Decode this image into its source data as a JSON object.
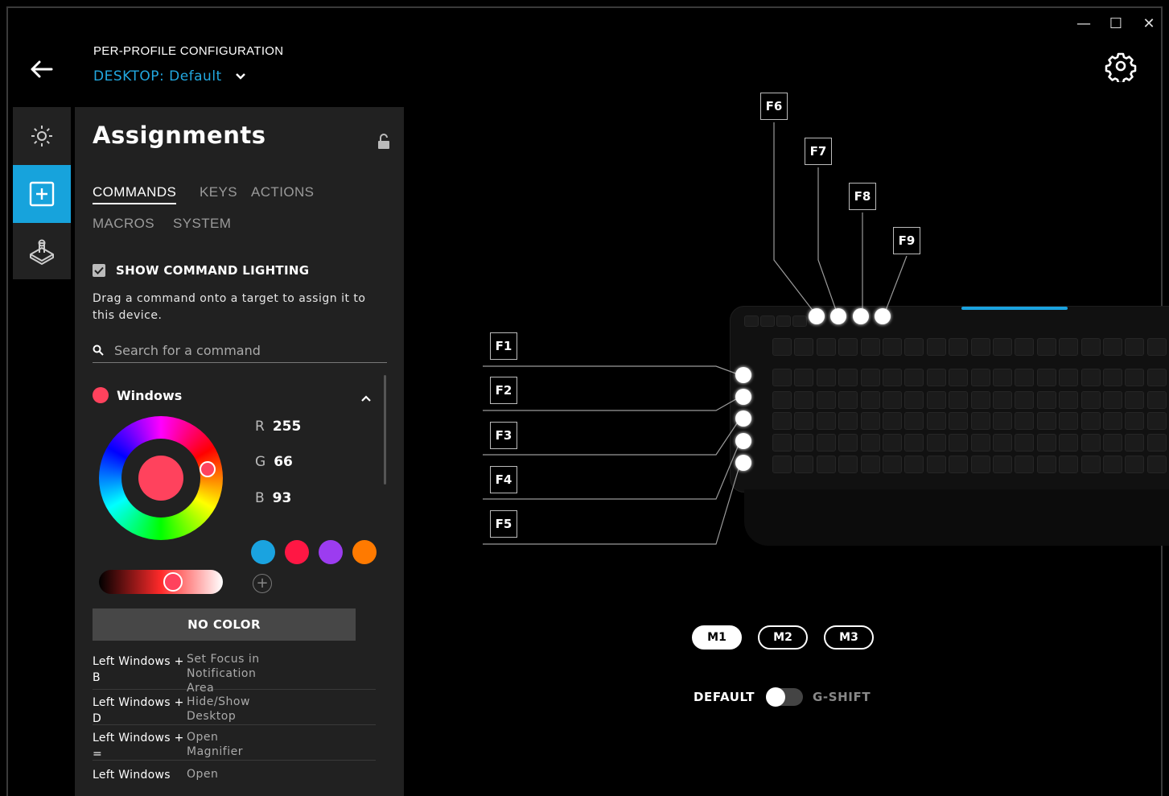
{
  "window": {
    "minimize": "—",
    "maximize": "☐",
    "close": "✕"
  },
  "header": {
    "title": "PER-PROFILE CONFIGURATION",
    "profile_prefix": "DESKTOP:",
    "profile_name": "Default"
  },
  "rail": {
    "items": [
      "lighting-icon",
      "assignments-icon",
      "gaming-mode-icon"
    ],
    "active": "assignments-icon"
  },
  "panel": {
    "title": "Assignments",
    "tabs": [
      "COMMANDS",
      "KEYS",
      "ACTIONS",
      "MACROS",
      "SYSTEM"
    ],
    "active_tab": "COMMANDS",
    "show_lighting_label": "SHOW COMMAND LIGHTING",
    "show_lighting_checked": true,
    "help_text": "Drag a command onto a target to assign it to this device.",
    "search_placeholder": "Search for a command",
    "group": {
      "name": "Windows",
      "color": "#ff425d"
    },
    "rgb": {
      "r_label": "R",
      "r": "255",
      "g_label": "G",
      "g": "66",
      "b_label": "B",
      "b": "93"
    },
    "swatches": [
      "#1aa3e0",
      "#ff1744",
      "#9c3cf0",
      "#ff7a00"
    ],
    "add_swatch": "+",
    "no_color": "NO COLOR",
    "commands": [
      {
        "key": "Left Windows + B",
        "desc": "Set Focus in Notification Area"
      },
      {
        "key": "Left Windows + D",
        "desc": "Hide/Show Desktop"
      },
      {
        "key": "Left Windows + =",
        "desc": "Open Magnifier"
      },
      {
        "key": "Left Windows",
        "desc": "Open"
      }
    ]
  },
  "device": {
    "top_keys": [
      "F6",
      "F7",
      "F8",
      "F9"
    ],
    "side_keys": [
      "F1",
      "F2",
      "F3",
      "F4",
      "F5"
    ],
    "memory": [
      "M1",
      "M2",
      "M3"
    ],
    "active_memory": "M1",
    "mode_left": "DEFAULT",
    "mode_right": "G-SHIFT",
    "gshift_on": false,
    "accent": "#1aa3e0"
  }
}
